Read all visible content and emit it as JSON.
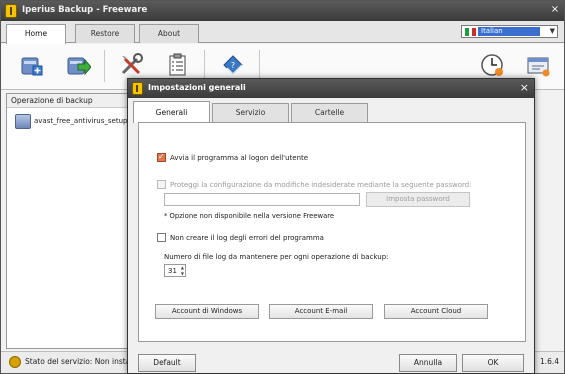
{
  "window": {
    "title": "Iperius Backup - Freeware",
    "tabs": [
      {
        "label": "Home"
      },
      {
        "label": "Restore"
      },
      {
        "label": "About"
      }
    ],
    "language": "Italian"
  },
  "toolbar": {
    "icons": [
      "new-backup-icon",
      "run-backup-icon",
      "tools-icon",
      "checklist-icon",
      "help-book-icon",
      "scheduler-clock-icon",
      "console-icon"
    ]
  },
  "backup_panel": {
    "header": "Operazione di backup",
    "items": [
      {
        "label": "avast_free_antivirus_setup.exe"
      }
    ]
  },
  "status": {
    "text": "Stato del servizio: Non installato",
    "version": "1.6.4"
  },
  "dialog": {
    "title": "Impostazioni generali",
    "tabs": [
      {
        "label": "Generali"
      },
      {
        "label": "Servizio"
      },
      {
        "label": "Cartelle"
      }
    ],
    "start_on_logon": {
      "label": "Avvia il programma al logon dell'utente",
      "checked": true
    },
    "protect_config": {
      "label": "Proteggi la configurazione da modifiche indesiderate mediante la seguente password:",
      "checked": false
    },
    "password_value": "",
    "password_button": "Imposta password",
    "note": "* Opzione non disponibile nella versione Freeware",
    "no_error_log": {
      "label": "Non creare il log degli errori del programma",
      "checked": false
    },
    "log_count_label": "Numero di file log da mantenere per ogni operazione di backup:",
    "log_count_value": "31",
    "account_buttons": [
      {
        "label": "Account di Windows"
      },
      {
        "label": "Account E-mail"
      },
      {
        "label": "Account Cloud"
      }
    ],
    "default_button": "Default",
    "cancel_button": "Annulla",
    "ok_button": "OK"
  },
  "colors": {
    "title_bar": "#3b3b3b",
    "checkbox_accent": "#e2774a",
    "selection_blue": "#3a6fcf",
    "app_icon": "#f5c400"
  }
}
